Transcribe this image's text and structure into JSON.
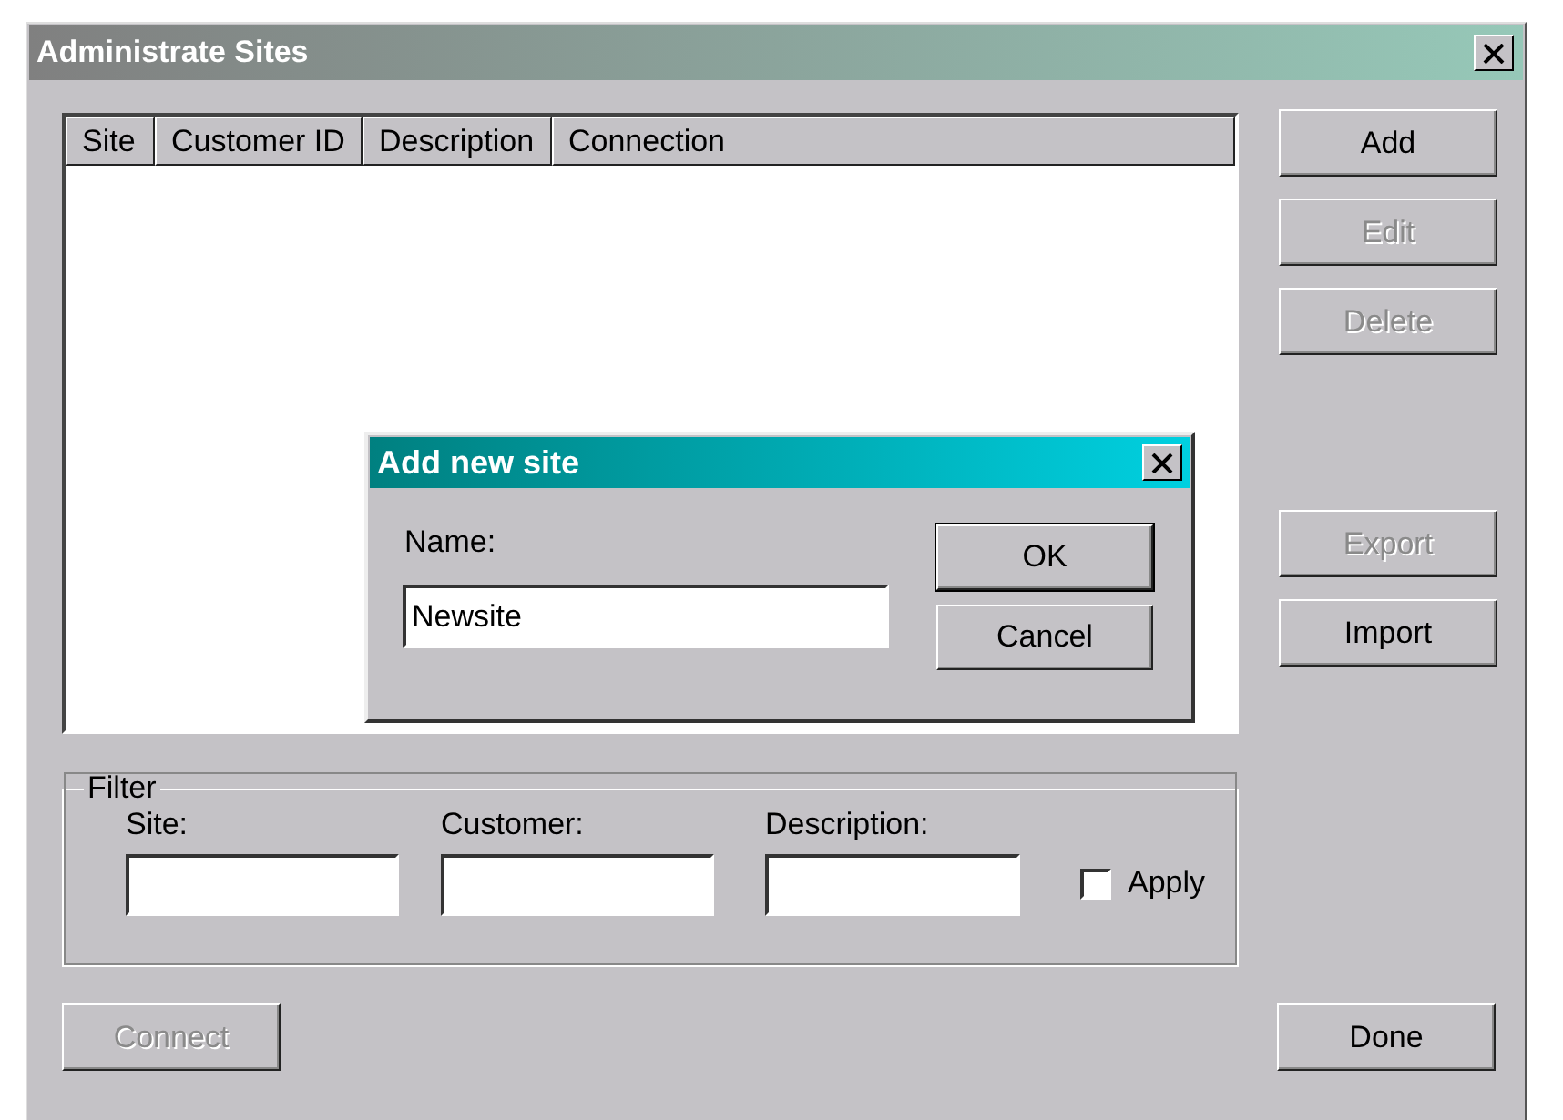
{
  "window": {
    "title": "Administrate Sites"
  },
  "table": {
    "columns": [
      "Site",
      "Customer ID",
      "Description",
      "Connection"
    ]
  },
  "side_buttons": [
    [
      {
        "label": "Add",
        "disabled": false
      },
      {
        "label": "Edit",
        "disabled": true
      },
      {
        "label": "Delete",
        "disabled": true
      }
    ],
    [
      {
        "label": "Export",
        "disabled": true
      },
      {
        "label": "Import",
        "disabled": false
      }
    ]
  ],
  "filter": {
    "title": "Filter",
    "fields": [
      {
        "label": "Site:"
      },
      {
        "label": "Customer:"
      },
      {
        "label": "Description:"
      }
    ],
    "apply": {
      "label": "Apply",
      "checked": false
    }
  },
  "footer_buttons": [
    {
      "label": "Connect",
      "disabled": true
    },
    {
      "label": "Done",
      "disabled": false
    }
  ],
  "dialog": {
    "title": "Add new site",
    "name_label": "Name:",
    "name_value": "Newsite",
    "buttons": [
      {
        "label": "OK",
        "default": true
      },
      {
        "label": "Cancel",
        "default": false
      }
    ]
  }
}
